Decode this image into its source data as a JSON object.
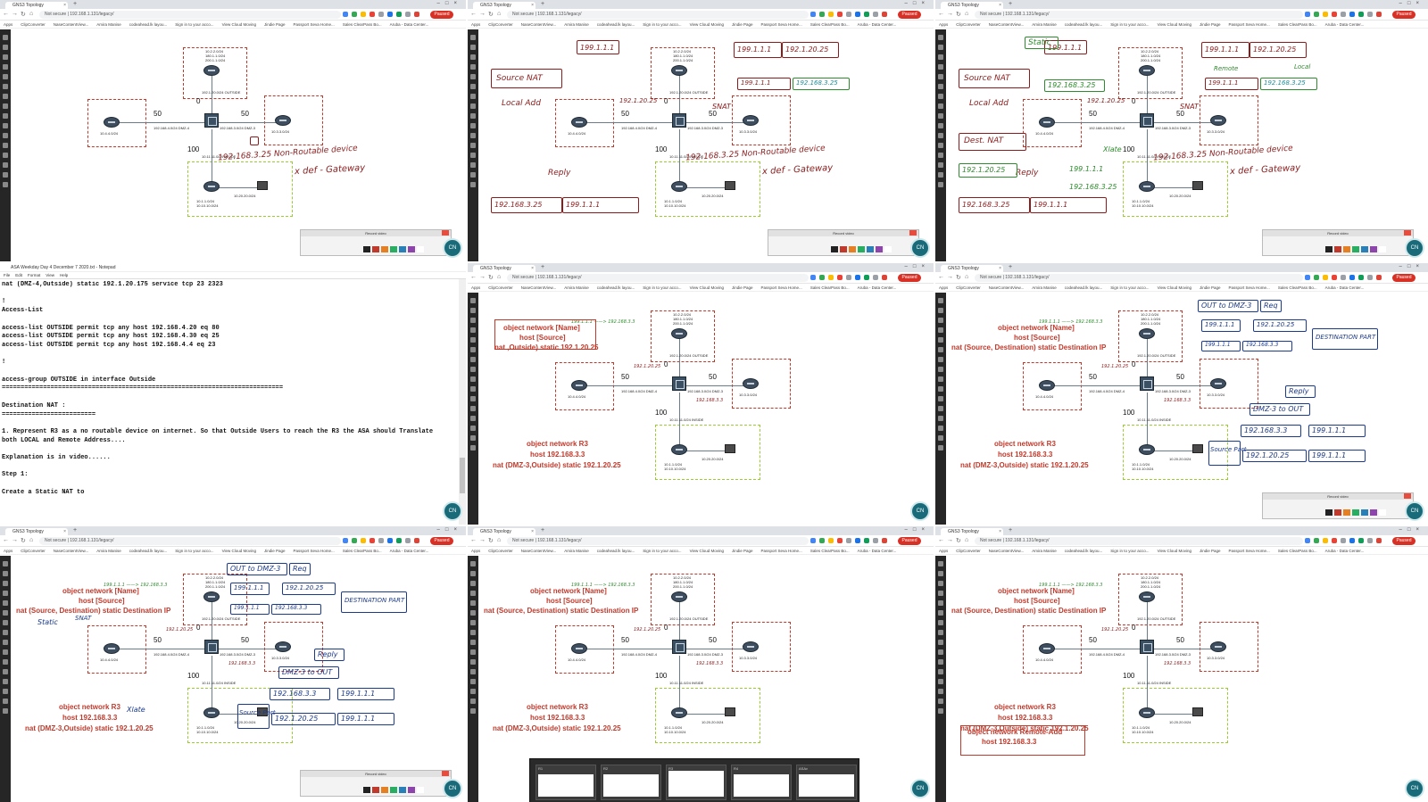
{
  "browser": {
    "tab_title": "GNS3 Topology",
    "address": "Not secure | 192.168.1.131/legacy/",
    "paused_label": "Paused",
    "bookmarks": [
      "Apps",
      "ClipConverter",
      "NaseContentView...",
      "Amira Manise",
      "codeahead.lk layou...",
      "Sign in to your acco...",
      "View Cloud Moving",
      "Jindie Page",
      "Passport Seva Home...",
      "Sales ClearPass Bo...",
      "Aruba - Data Center..."
    ],
    "notifications_label": "Notifications"
  },
  "topology": {
    "dmz2_label": "10.2.2.0/24\n180.1.1.0/24\n200.1.1.0/24",
    "r1_label": "10.4.4.0/24",
    "r3_label": "10.3.3.0/24",
    "dmz4_label": "192.168.4.0/24 DMZ-4",
    "dmz3_label": "192.168.3.0/24 DMZ-3",
    "outside_label": "192.1.20.0/24 OUTSIDE",
    "inside_label": "10.11.11.0/24 INSIDE",
    "r4_label": "10.1.1.0/24\n10.10.10.0/24",
    "pc_label": "10.20.20.0/24",
    "sec_0": "0",
    "sec_50a": "50",
    "sec_50b": "50",
    "sec_100": "100"
  },
  "annotations": {
    "source_nat": "Source NAT",
    "local_add": "Local Add",
    "dest_nat": "Dest. NAT",
    "static": "Static",
    "snat": "SNAT",
    "non_routable": "192.168.3.25 Non-Routable device",
    "def_gateway": "x def - Gateway",
    "reply": "Reply",
    "req": "Req",
    "xlate": "Xlate",
    "remote": "Remote",
    "local": "Local",
    "ip_199_1_1_1": "199.1.1.1",
    "ip_192_1_20_25": "192.1.20.25",
    "ip_192_168_3_25": "192.168.3.25",
    "ip_192_168_3_3": "192.168.3.3",
    "ip_192_168_3_3b": "192.168.3.3",
    "out_to_dmz3": "OUT to DMZ-3",
    "dmz3_to_out": "DMZ-3 to OUT",
    "destination_part": "DESTINATION PART",
    "source_part": "Source Part",
    "arrow_199_to_3_3": "199.1.1.1 ——> 192.168.3.3",
    "ip_192_1_20_25_small": "192.1.20.25",
    "ip_192_168_3_3_small": "192.168.3.3"
  },
  "notes": {
    "obj_name": "object network [Name]",
    "host_source": "host [Source]",
    "nat_outside_static": "nat ,Outside) static 192.1.20.25",
    "nat_src_dst": "nat (Source, Destination) static Destination IP",
    "obj_r3": "object network R3",
    "host_r3": "host 192.168.3.3",
    "nat_dmz3": "nat (DMZ-3,Outside) static 192.1.20.25",
    "obj_remote": "object network Remote-Add",
    "host_remote": "host 192.168.3.3"
  },
  "notepad": {
    "title": "ASA Weekday Day 4 December 7 2020.txt - Notepad",
    "menu": [
      "File",
      "Edit",
      "Format",
      "View",
      "Help"
    ],
    "body": "nat (DMZ-4,Outside) static 192.1.20.175 service tcp 23 2323\n\n!\nAccess-List\n\naccess-list OUTSIDE permit tcp any host 192.168.4.20 eq 80\naccess-list OUTSIDE permit tcp any host 192.168.4.30 eq 25\naccess-list OUTSIDE permit tcp any host 192.168.4.4 eq 23\n\n!\n\naccess-group OUTSIDE in interface Outside\n===========================================================================\n\nDestination NAT :\n=========================\n\n1. Represent R3 as a no routable device on internet. So that Outside Users to reach the R3 the ASA should Translate\nboth LOCAL and Remote Address....\n\nExplanation is in video......\n\nStep 1:\n\nCreate a Static NAT to"
  },
  "recorder": {
    "title": "Record video",
    "colors": [
      "#222222",
      "#c0392b",
      "#e67e22",
      "#27ae60",
      "#2980b9",
      "#8e44ad",
      "#ffffff"
    ]
  },
  "taskbar_thumbs": [
    "R1",
    "R2",
    "R3",
    "R4",
    "ASAv"
  ],
  "logo_text": "CN"
}
